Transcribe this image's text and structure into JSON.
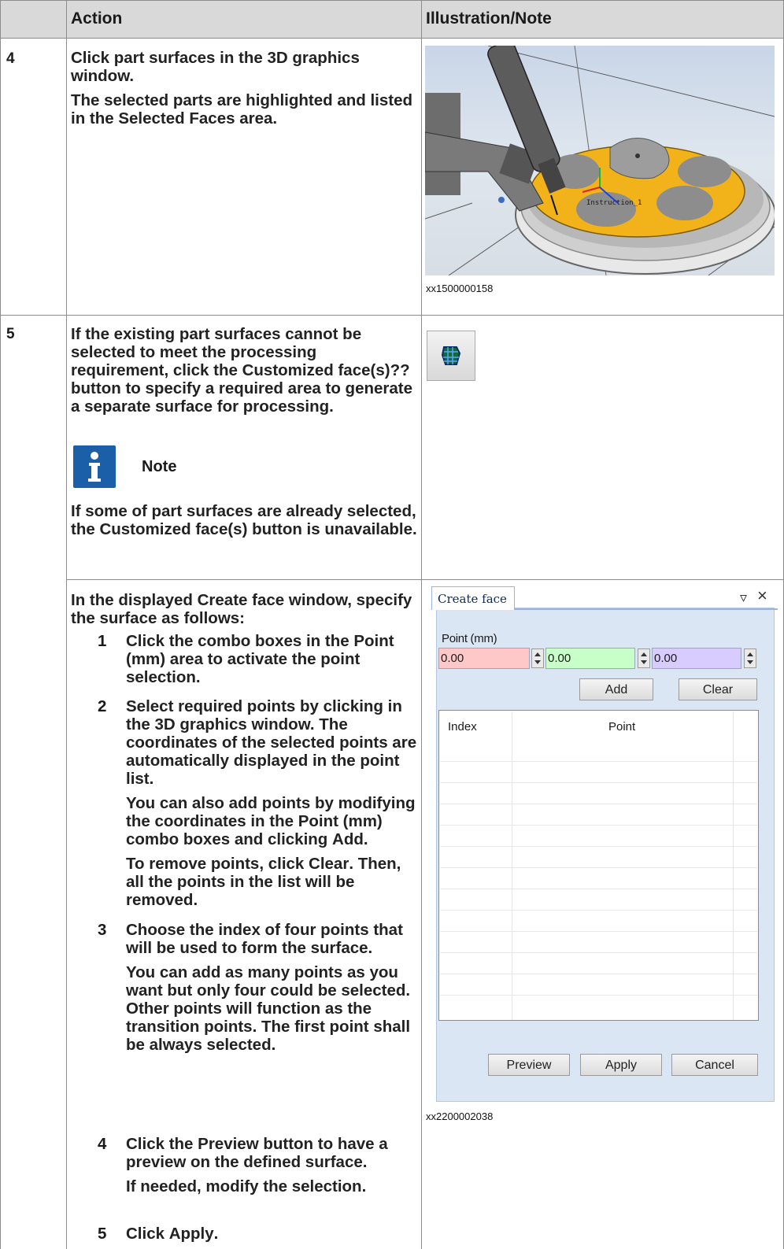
{
  "header": {
    "action": "Action",
    "illustration": "Illustration/Note"
  },
  "step4": {
    "number": "4",
    "line1": "Click part surfaces in the 3D graphics window.",
    "line2_pre": "The selected parts are highlighted and listed in the ",
    "line2_bold": "Selected Faces",
    "line2_post": " area.",
    "scene_label": "Instruction_1",
    "caption": "xx1500000158"
  },
  "step5": {
    "number": "5",
    "p1_pre": "If the existing part surfaces cannot be selected to meet the processing requirement, click the ",
    "p1_bold": "Customized face(s)??",
    "p1_post": " button to specify a required area to generate a separate surface for processing.",
    "note_label": "Note",
    "note_pre": "If some of part surfaces are already selected, the ",
    "note_bold": "Customized face(s)",
    "note_post": " button is unavailable.",
    "icon_name": "customized-face-icon"
  },
  "step6": {
    "intro_pre": "In the displayed ",
    "intro_bold": "Create face",
    "intro_post": " window, specify the surface as follows:",
    "items": [
      {
        "n": "1",
        "text_pre": "Click the combo boxes in the ",
        "text_bold": "Point (mm)",
        "text_post": " area to activate the point selection."
      },
      {
        "n": "2",
        "text": "Select required points by clicking in the 3D graphics window. The coordinates of the selected points are automatically displayed in the point list.",
        "sub1_pre": "You can also add points by modifying the coordinates in the ",
        "sub1_bold": "Point (mm)",
        "sub1_mid": " combo boxes and clicking ",
        "sub1_bold2": "Add",
        "sub1_post": ".",
        "sub2_pre": "To remove points, click ",
        "sub2_bold": "Clear",
        "sub2_post": ". Then, all the points in the list will be removed."
      },
      {
        "n": "3",
        "text": "Choose the index of four points that will be used to form the surface.",
        "sub1": "You can add as many points as you want but only four could be selected. Other points will function as the transition points. The first point shall be always selected."
      },
      {
        "n": "4",
        "text_pre": "Click the ",
        "text_bold": "Preview",
        "text_post": " button to have a preview on the defined surface.",
        "sub1": "If needed, modify the selection."
      },
      {
        "n": "5",
        "text_pre": "Click ",
        "text_bold": "Apply",
        "text_post": "."
      }
    ]
  },
  "create_face": {
    "tab": "Create face",
    "pin_glyph": "▿",
    "close_glyph": "×",
    "point_label": "Point (mm)",
    "x": "0.00",
    "y": "0.00",
    "z": "0.00",
    "x_color": "#ffc8c8",
    "y_color": "#c8ffc8",
    "z_color": "#d8ccff",
    "add": "Add",
    "clear": "Clear",
    "col_index": "Index",
    "col_point": "Point",
    "preview": "Preview",
    "apply": "Apply",
    "cancel": "Cancel",
    "caption": "xx2200002038"
  }
}
